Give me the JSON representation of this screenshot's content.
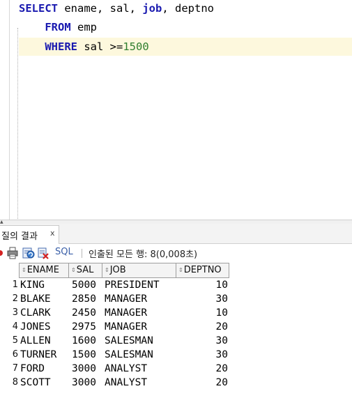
{
  "editor": {
    "lines": [
      [
        {
          "t": "SELECT",
          "c": "kw"
        },
        {
          "t": " ename, sal, ",
          "c": ""
        },
        {
          "t": "job",
          "c": "kw"
        },
        {
          "t": ", deptno",
          "c": ""
        }
      ],
      [
        {
          "t": "    ",
          "c": ""
        },
        {
          "t": "FROM",
          "c": "kw"
        },
        {
          "t": " emp",
          "c": ""
        }
      ],
      [
        {
          "t": "    ",
          "c": ""
        },
        {
          "t": "WHERE",
          "c": "kw"
        },
        {
          "t": " sal >=",
          "c": ""
        },
        {
          "t": "1500",
          "c": "num"
        }
      ]
    ]
  },
  "results": {
    "tab_label": "질의 결과",
    "tab_close": "x",
    "toolbar_sql": "SQL",
    "status": "인출된 모든 행: 8(0,008초)",
    "columns": [
      "ENAME",
      "SAL",
      "JOB",
      "DEPTNO"
    ],
    "rows": [
      {
        "n": "1",
        "ename": "KING",
        "sal": "5000",
        "job": "PRESIDENT",
        "deptno": "10"
      },
      {
        "n": "2",
        "ename": "BLAKE",
        "sal": "2850",
        "job": "MANAGER",
        "deptno": "30"
      },
      {
        "n": "3",
        "ename": "CLARK",
        "sal": "2450",
        "job": "MANAGER",
        "deptno": "10"
      },
      {
        "n": "4",
        "ename": "JONES",
        "sal": "2975",
        "job": "MANAGER",
        "deptno": "20"
      },
      {
        "n": "5",
        "ename": "ALLEN",
        "sal": "1600",
        "job": "SALESMAN",
        "deptno": "30"
      },
      {
        "n": "6",
        "ename": "TURNER",
        "sal": "1500",
        "job": "SALESMAN",
        "deptno": "30"
      },
      {
        "n": "7",
        "ename": "FORD",
        "sal": "3000",
        "job": "ANALYST",
        "deptno": "20"
      },
      {
        "n": "8",
        "ename": "SCOTT",
        "sal": "3000",
        "job": "ANALYST",
        "deptno": "20"
      }
    ]
  },
  "icons": [
    "pin-icon",
    "print-icon",
    "refresh-icon",
    "clear-icon",
    "sort-icon",
    "close-icon"
  ]
}
